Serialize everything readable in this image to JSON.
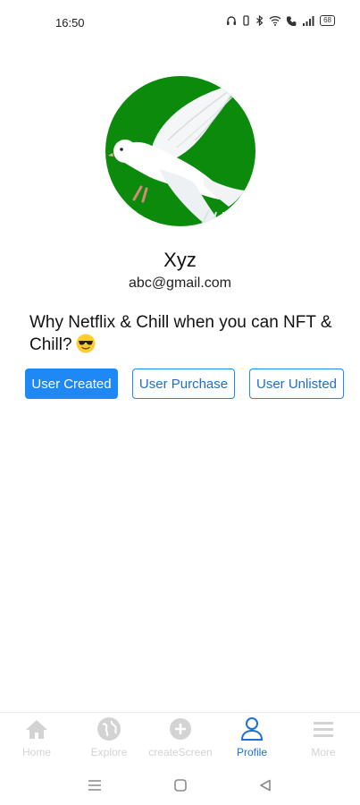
{
  "status_bar": {
    "time": "16:50",
    "battery": "68"
  },
  "profile": {
    "name": "Xyz",
    "email": "abc@gmail.com",
    "bio": "Why Netflix & Chill when you can NFT & Chill?"
  },
  "tabs": [
    {
      "label": "User Created",
      "active": true
    },
    {
      "label": "User Purchase",
      "active": false
    },
    {
      "label": "User Unlisted",
      "active": false
    }
  ],
  "bottom_nav": [
    {
      "label": "Home",
      "icon": "home-icon"
    },
    {
      "label": "Explore",
      "icon": "globe-icon"
    },
    {
      "label": "createScreen",
      "icon": "plus-circle-icon"
    },
    {
      "label": "Profile",
      "icon": "person-icon",
      "active": true
    },
    {
      "label": "More",
      "icon": "menu-icon"
    }
  ],
  "colors": {
    "accent": "#1e88f5",
    "avatar_background": "#0b8a0b",
    "inactive_nav": "#d3d3d3"
  }
}
